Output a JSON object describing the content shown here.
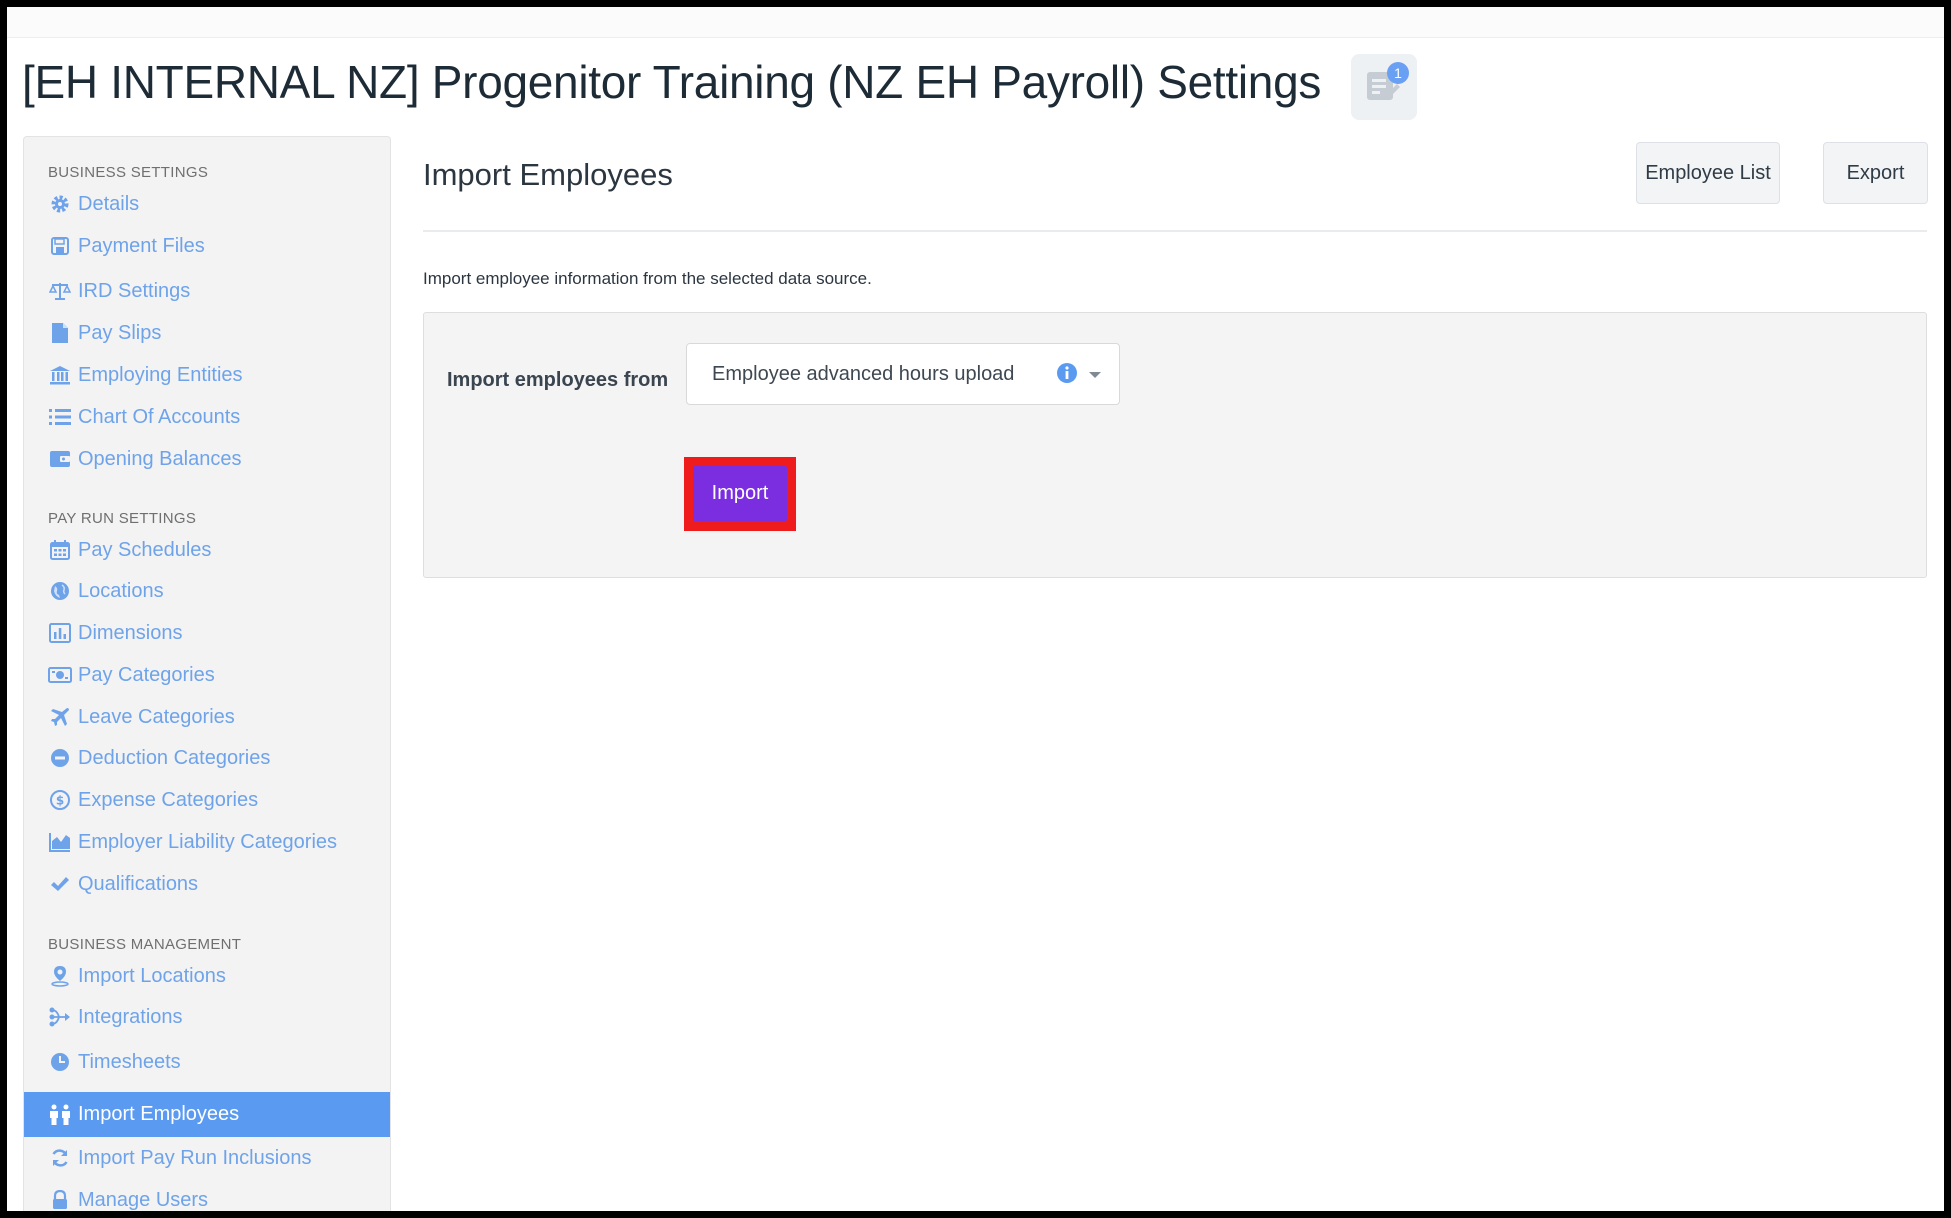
{
  "page": {
    "title": "[EH INTERNAL NZ] Progenitor Training (NZ EH Payroll) Settings",
    "notes_badge_count": "1",
    "notes_icon": "notes-icon"
  },
  "colors": {
    "link": "#6ea3ea",
    "active_bg": "#5b9af1",
    "import_button": "#7a2ee0",
    "highlight": "#ee1c1c"
  },
  "sidebar": {
    "sections": [
      {
        "heading": "BUSINESS SETTINGS",
        "items": [
          {
            "label": "Details",
            "icon": "gear-icon"
          },
          {
            "label": "Payment Files",
            "icon": "floppy-disk-icon"
          },
          {
            "label": "IRD Settings",
            "icon": "scales-icon"
          },
          {
            "label": "Pay Slips",
            "icon": "document-icon"
          },
          {
            "label": "Employing Entities",
            "icon": "bank-icon"
          },
          {
            "label": "Chart Of Accounts",
            "icon": "list-icon"
          },
          {
            "label": "Opening Balances",
            "icon": "wallet-icon"
          }
        ]
      },
      {
        "heading": "PAY RUN SETTINGS",
        "items": [
          {
            "label": "Pay Schedules",
            "icon": "calendar-icon"
          },
          {
            "label": "Locations",
            "icon": "globe-icon"
          },
          {
            "label": "Dimensions",
            "icon": "bar-chart-icon"
          },
          {
            "label": "Pay Categories",
            "icon": "money-icon"
          },
          {
            "label": "Leave Categories",
            "icon": "plane-icon"
          },
          {
            "label": "Deduction Categories",
            "icon": "minus-circle-icon"
          },
          {
            "label": "Expense Categories",
            "icon": "dollar-circle-icon"
          },
          {
            "label": "Employer Liability Categories",
            "icon": "area-chart-icon"
          },
          {
            "label": "Qualifications",
            "icon": "check-icon"
          }
        ]
      },
      {
        "heading": "BUSINESS MANAGEMENT",
        "items": [
          {
            "label": "Import Locations",
            "icon": "map-pin-icon"
          },
          {
            "label": "Integrations",
            "icon": "share-nodes-icon"
          },
          {
            "label": "Timesheets",
            "icon": "clock-icon"
          },
          {
            "label": "Import Employees",
            "icon": "people-icon",
            "active": true
          },
          {
            "label": "Import Pay Run Inclusions",
            "icon": "refresh-icon"
          },
          {
            "label": "Manage Users",
            "icon": "lock-icon"
          }
        ]
      }
    ]
  },
  "main": {
    "title": "Import Employees",
    "employee_list_label": "Employee List",
    "export_label": "Export",
    "intro": "Import employee information from the selected data source.",
    "import_from_label": "Import employees from",
    "data_source_selected": "Employee advanced hours upload",
    "import_label": "Import"
  }
}
